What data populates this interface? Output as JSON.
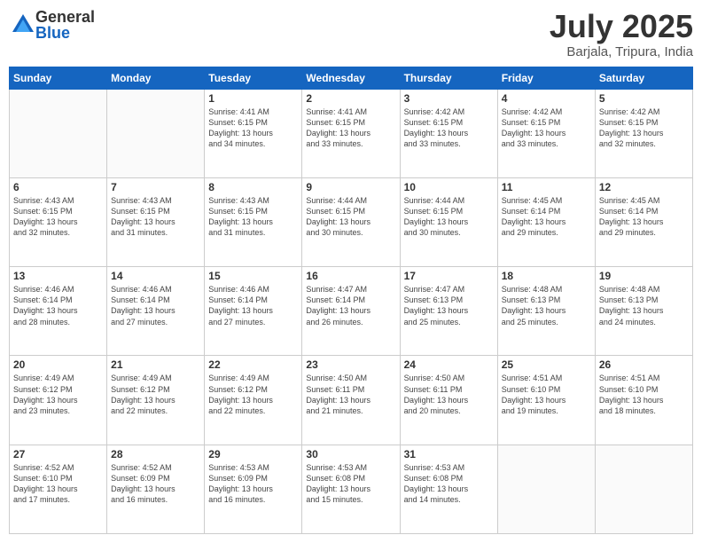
{
  "header": {
    "logo_general": "General",
    "logo_blue": "Blue",
    "month_title": "July 2025",
    "location": "Barjala, Tripura, India"
  },
  "days_of_week": [
    "Sunday",
    "Monday",
    "Tuesday",
    "Wednesday",
    "Thursday",
    "Friday",
    "Saturday"
  ],
  "weeks": [
    [
      {
        "day": "",
        "info": ""
      },
      {
        "day": "",
        "info": ""
      },
      {
        "day": "1",
        "info": "Sunrise: 4:41 AM\nSunset: 6:15 PM\nDaylight: 13 hours\nand 34 minutes."
      },
      {
        "day": "2",
        "info": "Sunrise: 4:41 AM\nSunset: 6:15 PM\nDaylight: 13 hours\nand 33 minutes."
      },
      {
        "day": "3",
        "info": "Sunrise: 4:42 AM\nSunset: 6:15 PM\nDaylight: 13 hours\nand 33 minutes."
      },
      {
        "day": "4",
        "info": "Sunrise: 4:42 AM\nSunset: 6:15 PM\nDaylight: 13 hours\nand 33 minutes."
      },
      {
        "day": "5",
        "info": "Sunrise: 4:42 AM\nSunset: 6:15 PM\nDaylight: 13 hours\nand 32 minutes."
      }
    ],
    [
      {
        "day": "6",
        "info": "Sunrise: 4:43 AM\nSunset: 6:15 PM\nDaylight: 13 hours\nand 32 minutes."
      },
      {
        "day": "7",
        "info": "Sunrise: 4:43 AM\nSunset: 6:15 PM\nDaylight: 13 hours\nand 31 minutes."
      },
      {
        "day": "8",
        "info": "Sunrise: 4:43 AM\nSunset: 6:15 PM\nDaylight: 13 hours\nand 31 minutes."
      },
      {
        "day": "9",
        "info": "Sunrise: 4:44 AM\nSunset: 6:15 PM\nDaylight: 13 hours\nand 30 minutes."
      },
      {
        "day": "10",
        "info": "Sunrise: 4:44 AM\nSunset: 6:15 PM\nDaylight: 13 hours\nand 30 minutes."
      },
      {
        "day": "11",
        "info": "Sunrise: 4:45 AM\nSunset: 6:14 PM\nDaylight: 13 hours\nand 29 minutes."
      },
      {
        "day": "12",
        "info": "Sunrise: 4:45 AM\nSunset: 6:14 PM\nDaylight: 13 hours\nand 29 minutes."
      }
    ],
    [
      {
        "day": "13",
        "info": "Sunrise: 4:46 AM\nSunset: 6:14 PM\nDaylight: 13 hours\nand 28 minutes."
      },
      {
        "day": "14",
        "info": "Sunrise: 4:46 AM\nSunset: 6:14 PM\nDaylight: 13 hours\nand 27 minutes."
      },
      {
        "day": "15",
        "info": "Sunrise: 4:46 AM\nSunset: 6:14 PM\nDaylight: 13 hours\nand 27 minutes."
      },
      {
        "day": "16",
        "info": "Sunrise: 4:47 AM\nSunset: 6:14 PM\nDaylight: 13 hours\nand 26 minutes."
      },
      {
        "day": "17",
        "info": "Sunrise: 4:47 AM\nSunset: 6:13 PM\nDaylight: 13 hours\nand 25 minutes."
      },
      {
        "day": "18",
        "info": "Sunrise: 4:48 AM\nSunset: 6:13 PM\nDaylight: 13 hours\nand 25 minutes."
      },
      {
        "day": "19",
        "info": "Sunrise: 4:48 AM\nSunset: 6:13 PM\nDaylight: 13 hours\nand 24 minutes."
      }
    ],
    [
      {
        "day": "20",
        "info": "Sunrise: 4:49 AM\nSunset: 6:12 PM\nDaylight: 13 hours\nand 23 minutes."
      },
      {
        "day": "21",
        "info": "Sunrise: 4:49 AM\nSunset: 6:12 PM\nDaylight: 13 hours\nand 22 minutes."
      },
      {
        "day": "22",
        "info": "Sunrise: 4:49 AM\nSunset: 6:12 PM\nDaylight: 13 hours\nand 22 minutes."
      },
      {
        "day": "23",
        "info": "Sunrise: 4:50 AM\nSunset: 6:11 PM\nDaylight: 13 hours\nand 21 minutes."
      },
      {
        "day": "24",
        "info": "Sunrise: 4:50 AM\nSunset: 6:11 PM\nDaylight: 13 hours\nand 20 minutes."
      },
      {
        "day": "25",
        "info": "Sunrise: 4:51 AM\nSunset: 6:10 PM\nDaylight: 13 hours\nand 19 minutes."
      },
      {
        "day": "26",
        "info": "Sunrise: 4:51 AM\nSunset: 6:10 PM\nDaylight: 13 hours\nand 18 minutes."
      }
    ],
    [
      {
        "day": "27",
        "info": "Sunrise: 4:52 AM\nSunset: 6:10 PM\nDaylight: 13 hours\nand 17 minutes."
      },
      {
        "day": "28",
        "info": "Sunrise: 4:52 AM\nSunset: 6:09 PM\nDaylight: 13 hours\nand 16 minutes."
      },
      {
        "day": "29",
        "info": "Sunrise: 4:53 AM\nSunset: 6:09 PM\nDaylight: 13 hours\nand 16 minutes."
      },
      {
        "day": "30",
        "info": "Sunrise: 4:53 AM\nSunset: 6:08 PM\nDaylight: 13 hours\nand 15 minutes."
      },
      {
        "day": "31",
        "info": "Sunrise: 4:53 AM\nSunset: 6:08 PM\nDaylight: 13 hours\nand 14 minutes."
      },
      {
        "day": "",
        "info": ""
      },
      {
        "day": "",
        "info": ""
      }
    ]
  ]
}
